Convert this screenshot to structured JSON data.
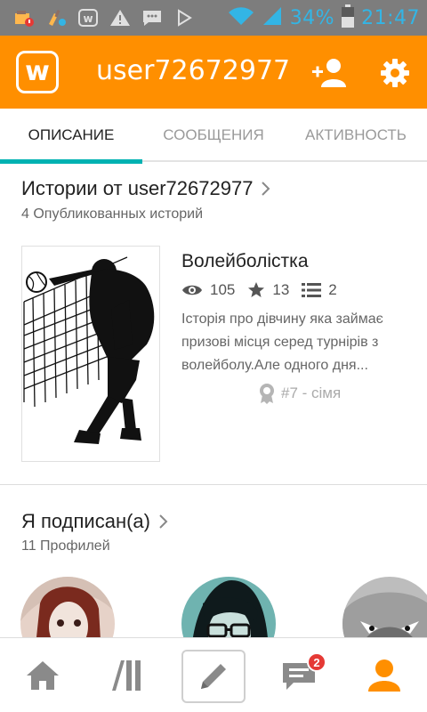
{
  "status_bar": {
    "battery_percent": "34%",
    "time": "21:47",
    "icons": [
      "sd-card-warning-icon",
      "cleaner-icon",
      "wattpad-notification-icon",
      "warning-icon",
      "message-icon",
      "play-store-icon",
      "wifi-icon",
      "signal-icon",
      "battery-icon"
    ]
  },
  "app_bar": {
    "logo_letter": "w",
    "username": "user72672977"
  },
  "tabs": [
    {
      "label": "ОПИСАНИЕ",
      "active": true
    },
    {
      "label": "СООБЩЕНИЯ",
      "active": false
    },
    {
      "label": "АКТИВНОСТЬ",
      "active": false
    }
  ],
  "stories": {
    "title": "Истории от user72672977",
    "subtitle": "4 Опубликованных историй",
    "items": [
      {
        "title": "Волейболістка",
        "reads": "105",
        "votes": "13",
        "parts": "2",
        "description": "Історія про дівчину яка займає призові місця серед турнірів з волейболу.Але одного дня...",
        "rank": "#7 - сімя"
      }
    ]
  },
  "following": {
    "title": "Я подписан(а)",
    "subtitle": "11 Профилей"
  },
  "bottom_nav": {
    "items": [
      "home-icon",
      "library-icon",
      "write-icon",
      "messages-icon",
      "profile-icon"
    ],
    "messages_badge": "2",
    "colors": {
      "active": "#ff8f00",
      "inactive": "#8a8a8a"
    }
  },
  "colors": {
    "brand": "#ff8f00",
    "tab_indicator": "#00b2b2",
    "status_text": "#33b5e5"
  }
}
